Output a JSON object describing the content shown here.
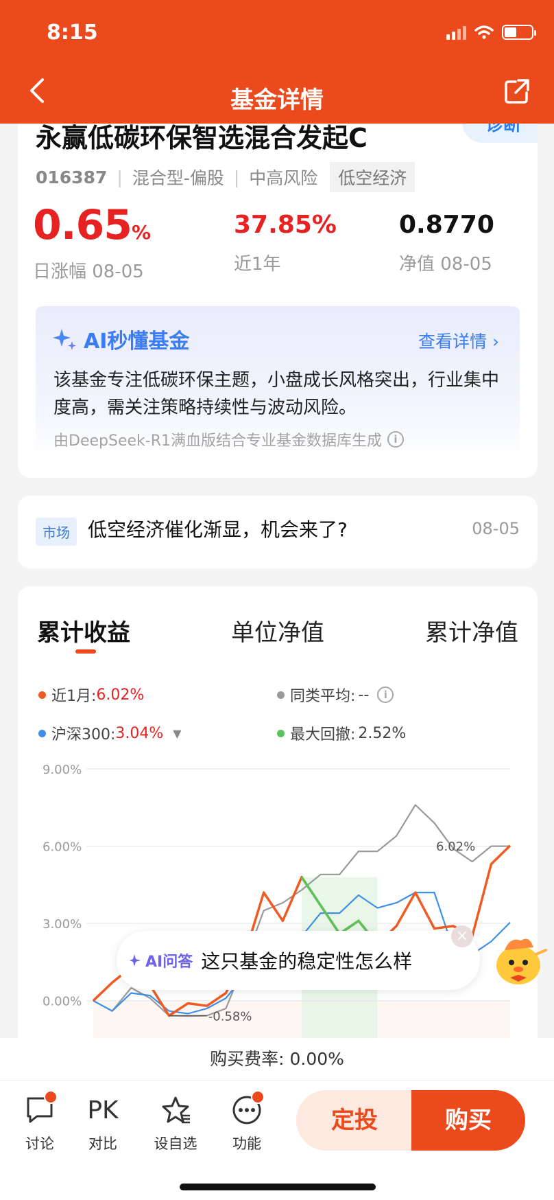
{
  "status": {
    "time": "8:15"
  },
  "header": {
    "title": "基金详情"
  },
  "fund": {
    "name": "永赢低碳环保智选混合发起C",
    "diagnose": "诊断",
    "code": "016387",
    "type": "混合型-偏股",
    "risk": "中高风险",
    "theme_tag": "低空经济",
    "daily_change": "0.65",
    "daily_change_unit": "%",
    "daily_change_label": "日涨幅 08-05",
    "year_return": "37.85%",
    "year_return_label": "近1年",
    "nav": "0.8770",
    "nav_label": "净值 08-05"
  },
  "ai_card": {
    "title": "AI秒懂基金",
    "more": "查看详情",
    "text": "该基金专注低碳环保主题，小盘成长风格突出，行业集中度高，需关注策略持续性与波动风险。",
    "source": "由DeepSeek-R1满血版结合专业基金数据库生成"
  },
  "news": {
    "tag": "市场",
    "text": "低空经济催化渐显，机会来了?",
    "date": "08-05"
  },
  "chart_tabs": [
    "累计收益",
    "单位净值",
    "累计净值"
  ],
  "legend": {
    "month_label": "近1月:",
    "month_value": "6.02%",
    "avg_label": "同类平均:",
    "avg_value": "--",
    "hs300_label": "沪深300:",
    "hs300_value": "3.04%",
    "drawdown_label": "最大回撤:",
    "drawdown_value": "2.52%"
  },
  "colors": {
    "fund": "#f05a23",
    "hs300": "#3d8fe8",
    "avg": "#999999",
    "drawdown": "#5cc35c",
    "brand": "#ea4a1c"
  },
  "chart_data": {
    "type": "line",
    "yticks": [
      "9.00%",
      "6.00%",
      "3.00%",
      "0.00%"
    ],
    "ylim": [
      -1.5,
      9
    ],
    "grid": true,
    "x": [
      0,
      1,
      2,
      3,
      4,
      5,
      6,
      7,
      8,
      9,
      10,
      11,
      12,
      13,
      14,
      15,
      16,
      17,
      18,
      19,
      20,
      21,
      22
    ],
    "series": [
      {
        "name": "近1月",
        "values": [
          0,
          0.7,
          1.3,
          0.6,
          -0.58,
          -0.1,
          -0.2,
          0.3,
          1.8,
          4.2,
          3.1,
          4.8,
          3.7,
          2.6,
          3.1,
          2.2,
          2.9,
          4.2,
          2.8,
          2.9,
          2.5,
          5.3,
          6.02
        ]
      },
      {
        "name": "同类平均",
        "values": [
          0,
          -0.4,
          0.5,
          0.1,
          -0.58,
          -0.6,
          -0.58,
          -0.3,
          1.5,
          3.5,
          3.8,
          4.3,
          4.9,
          4.9,
          5.8,
          5.8,
          6.4,
          7.6,
          6.9,
          5.9,
          5.4,
          6.0,
          6.0
        ]
      },
      {
        "name": "沪深300",
        "values": [
          0,
          -0.4,
          0.3,
          0.2,
          -0.4,
          -0.5,
          -0.3,
          0.1,
          1.0,
          2.0,
          2.4,
          2.5,
          3.4,
          3.4,
          4.1,
          3.6,
          3.8,
          4.2,
          4.2,
          2.0,
          1.8,
          2.3,
          3.04
        ]
      }
    ],
    "drawdown_marker": "-0.58%",
    "end_label": "6.02%"
  },
  "chat_bubble": {
    "ai_label": "AI问答",
    "question": "这只基金的稳定性怎么样"
  },
  "fee": {
    "text": "购买费率: 0.00%"
  },
  "bottom_nav": {
    "discuss": "讨论",
    "pk_glyph": "PK",
    "compare": "对比",
    "watch": "设自选",
    "func": "功能",
    "invest": "定投",
    "buy": "购买"
  }
}
